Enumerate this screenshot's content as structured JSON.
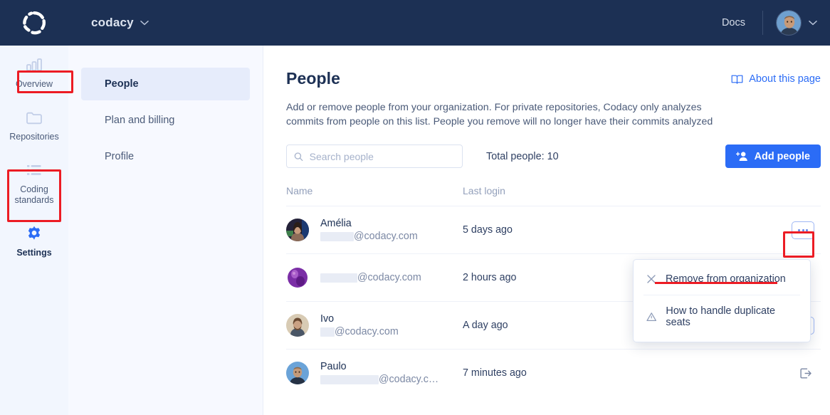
{
  "topbar": {
    "logo_icon": "codacy-dots-logo-icon",
    "org_name": "codacy",
    "org_chevron_icon": "chevron-down-icon",
    "docs_label": "Docs",
    "avatar_icon": "user-avatar",
    "account_chevron_icon": "chevron-down-icon",
    "background_color": "#1c3054"
  },
  "rail": {
    "items": [
      {
        "label": "Overview",
        "icon": "bar-chart-icon",
        "active": false
      },
      {
        "label": "Repositories",
        "icon": "folder-icon",
        "active": false
      },
      {
        "label": "Coding standards",
        "icon": "list-icon",
        "active": false
      },
      {
        "label": "Settings",
        "icon": "gear-icon",
        "active": true
      }
    ]
  },
  "subnav": {
    "items": [
      {
        "label": "People",
        "active": true
      },
      {
        "label": "Plan and billing",
        "active": false
      },
      {
        "label": "Profile",
        "active": false
      }
    ]
  },
  "page": {
    "title": "People",
    "description": "Add or remove people from your organization. For private repositories, Codacy only analyzes commits from people on this list. People you remove will no longer have their commits analyzed",
    "about_link": "About this page",
    "about_icon": "book-icon"
  },
  "toolbar": {
    "search_placeholder": "Search people",
    "search_value": "",
    "search_icon": "search-icon",
    "total_people": "Total people: 10",
    "add_people_label": "Add people",
    "add_people_icon": "add-user-icon",
    "accent_color": "#2b6cf6"
  },
  "table": {
    "columns": [
      "Name",
      "Last login"
    ],
    "rows": [
      {
        "name": "Amélia",
        "email_redacted_width": 47,
        "email_domain": "@codacy.com",
        "last_login": "5 days ago",
        "action": "dots",
        "avatar_colors": [
          "#2c2a3e",
          "#7d5e52",
          "#1f3a6e"
        ]
      },
      {
        "name": "",
        "email_redacted_width": 52,
        "email_domain": "@codacy.com",
        "last_login": "2 hours ago",
        "action": "none",
        "avatar_colors": [
          "#8e3fb0",
          "#5b1f7a",
          "#c07ad6"
        ]
      },
      {
        "name": "Ivo",
        "email_redacted_width": 20,
        "email_domain": "@codacy.com",
        "last_login": "A day ago",
        "action": "dots",
        "avatar_colors": [
          "#cbb79c",
          "#5a4536",
          "#8f765c"
        ]
      },
      {
        "name": "Paulo",
        "email_redacted_width": 82,
        "email_domain": "@codacy.c…",
        "last_login": "7 minutes ago",
        "action": "leave",
        "avatar_colors": [
          "#6aa3d8",
          "#c29a7c",
          "#2c3b52"
        ]
      }
    ]
  },
  "dropdown": {
    "items": [
      {
        "label": "Remove from organization",
        "icon": "close-x-icon"
      },
      {
        "label": "How to handle duplicate seats",
        "icon": "warning-triangle-icon"
      }
    ]
  },
  "annotations": {
    "highlight_color": "#ec1c24"
  }
}
